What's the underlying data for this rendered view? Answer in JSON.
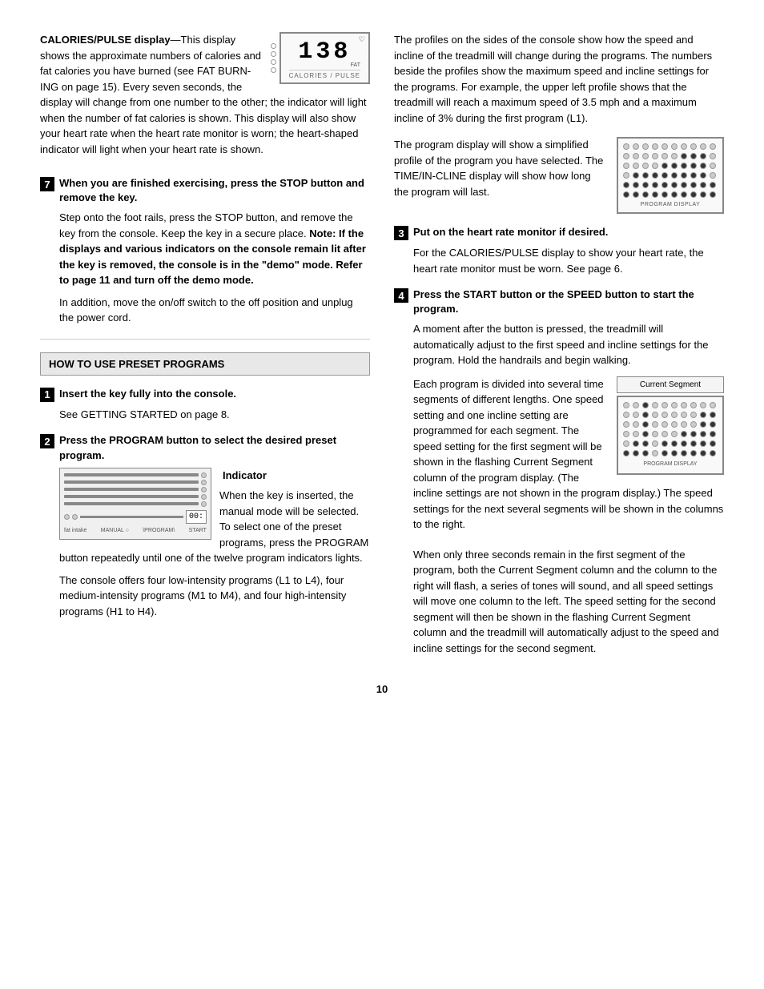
{
  "page": {
    "number": "10"
  },
  "left": {
    "calories_section": {
      "title": "CALORIES/PULSE",
      "display_bold": "display",
      "display_text": "—This display shows the approximate numbers of calories and fat calories you have burned (see FAT BURN-ING on page 15). Every seven seconds, the display will change from one number to the other; the indicator will light when the number of fat calories is shown. This display will also show your heart rate when the heart rate monitor is worn; the heart-shaped indicator will light when your heart rate is shown.",
      "lcd_number": "138",
      "lcd_label": "CALORIES / PULSE"
    },
    "step7": {
      "num": "7",
      "title": "When you are finished exercising, press the STOP button and remove the key.",
      "body1": "Step onto the foot rails, press the STOP button, and remove the key from the console. Keep the key in a secure place.",
      "bold_part": "Note: If the displays and various indicators on the console remain lit after the key is removed, the console is in the \"demo\" mode. Refer to page 11 and turn off the demo mode.",
      "body2": "In addition, move the on/off switch to the off position and unplug the power cord."
    },
    "preset_section": {
      "title": "HOW TO USE PRESET PROGRAMS",
      "step1": {
        "num": "1",
        "title": "Insert the key fully into the console.",
        "body": "See GETTING STARTED on page 8."
      },
      "step2": {
        "num": "2",
        "title": "Press the PROGRAM button to select the desired preset program.",
        "body1": "When the key is inserted, the manual mode will be selected. To select one of the preset programs, press the PROGRAM button repeatedly until one of the twelve program indicators lights.",
        "indicator_label": "Indicator",
        "body2": "The console offers four low-intensity programs (L1 to L4), four medium-intensity programs (M1 to M4), and four high-intensity programs (H1 to H4)."
      }
    }
  },
  "right": {
    "intro": "The profiles on the sides of the console show how the speed and incline of the treadmill will change during the programs. The numbers beside the profiles show the maximum speed and incline settings for the programs. For example, the upper left profile shows that the treadmill will reach a maximum speed of 3.5 mph and a maximum incline of 3% during the first program (L1).",
    "program_display_text1": "The program display will show a simplified profile of the program you have selected. The TIME/IN-CLINE display will show how long the program will last.",
    "program_display_label": "PROGRAM DISPLAY",
    "step3": {
      "num": "3",
      "title": "Put on the heart rate monitor if desired.",
      "body": "For the CALORIES/PULSE display to show your heart rate, the heart rate monitor must be worn. See page 6."
    },
    "step4": {
      "num": "4",
      "title": "Press the START button or the SPEED     button to start the program.",
      "body1": "A moment after the button is pressed, the treadmill will automatically adjust to the first speed and incline settings for the program. Hold the handrails and begin walking.",
      "segment_label": "Current Segment",
      "segment_display_label": "PROGRAM DISPLAY",
      "body2": "Each program is divided into several time segments of different lengths. One speed setting and one incline setting are programmed for each segment. The speed setting for the first segment will be shown in the flashing Current Segment column of the program display. (The incline settings are not shown in the program display.) The speed settings for the next several segments will be shown in the columns to the right.",
      "body3": "When only three seconds remain in the first segment of the program, both the Current Segment column and the column to the right will flash, a series of tones will sound, and all speed settings will move one column to the left. The speed setting for the second segment will then be shown in the flashing Current Segment column and the treadmill will automatically adjust to the speed and incline settings for the second segment."
    }
  }
}
